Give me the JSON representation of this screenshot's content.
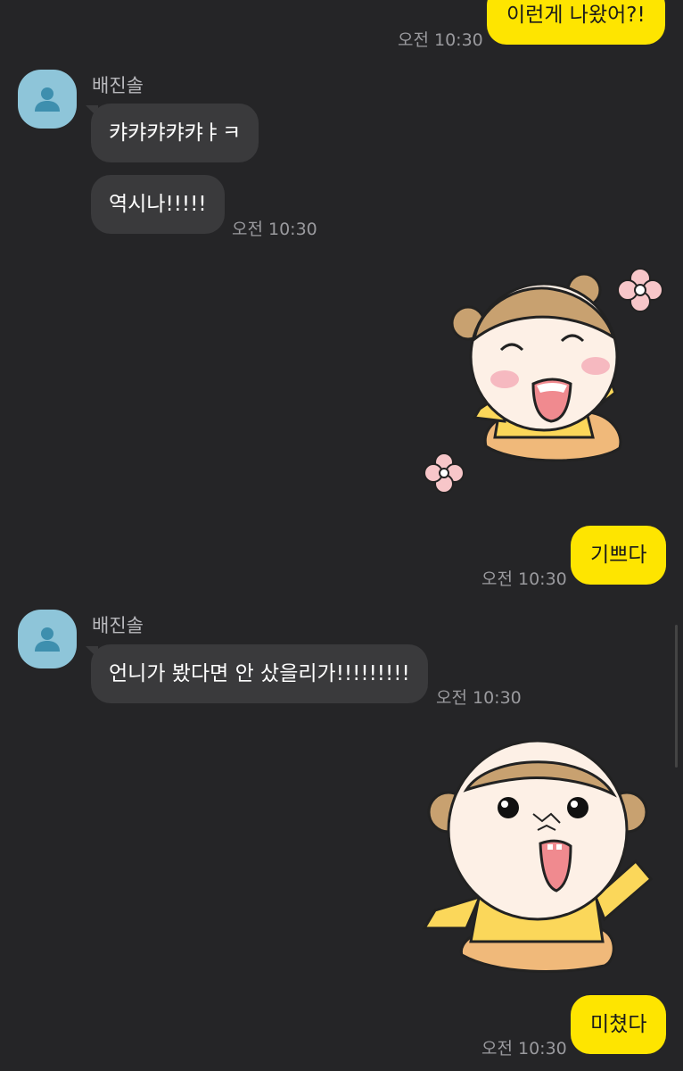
{
  "messages": {
    "m1": {
      "text": "이런게 나왔어?!",
      "time": "오전 10:30"
    },
    "group1": {
      "sender": "배진솔",
      "b1": "캬캬캬캬캬ㅑㅋ",
      "b2": "역시나!!!!!",
      "time": "오전 10:30"
    },
    "sticker1": {
      "name": "happy-girl-sticker"
    },
    "m2": {
      "text": "기쁘다",
      "time": "오전 10:30"
    },
    "group2": {
      "sender": "배진솔",
      "b1": "언니가 봤다면 안 샀을리가!!!!!!!!!",
      "time": "오전 10:30"
    },
    "sticker2": {
      "name": "shocked-girl-sticker"
    },
    "m3": {
      "text": "미쳤다",
      "time": "오전 10:30"
    }
  },
  "colors": {
    "background": "#252527",
    "my_bubble": "#FEE500",
    "other_bubble": "#3a3a3c",
    "avatar": "#8ec5d9"
  }
}
